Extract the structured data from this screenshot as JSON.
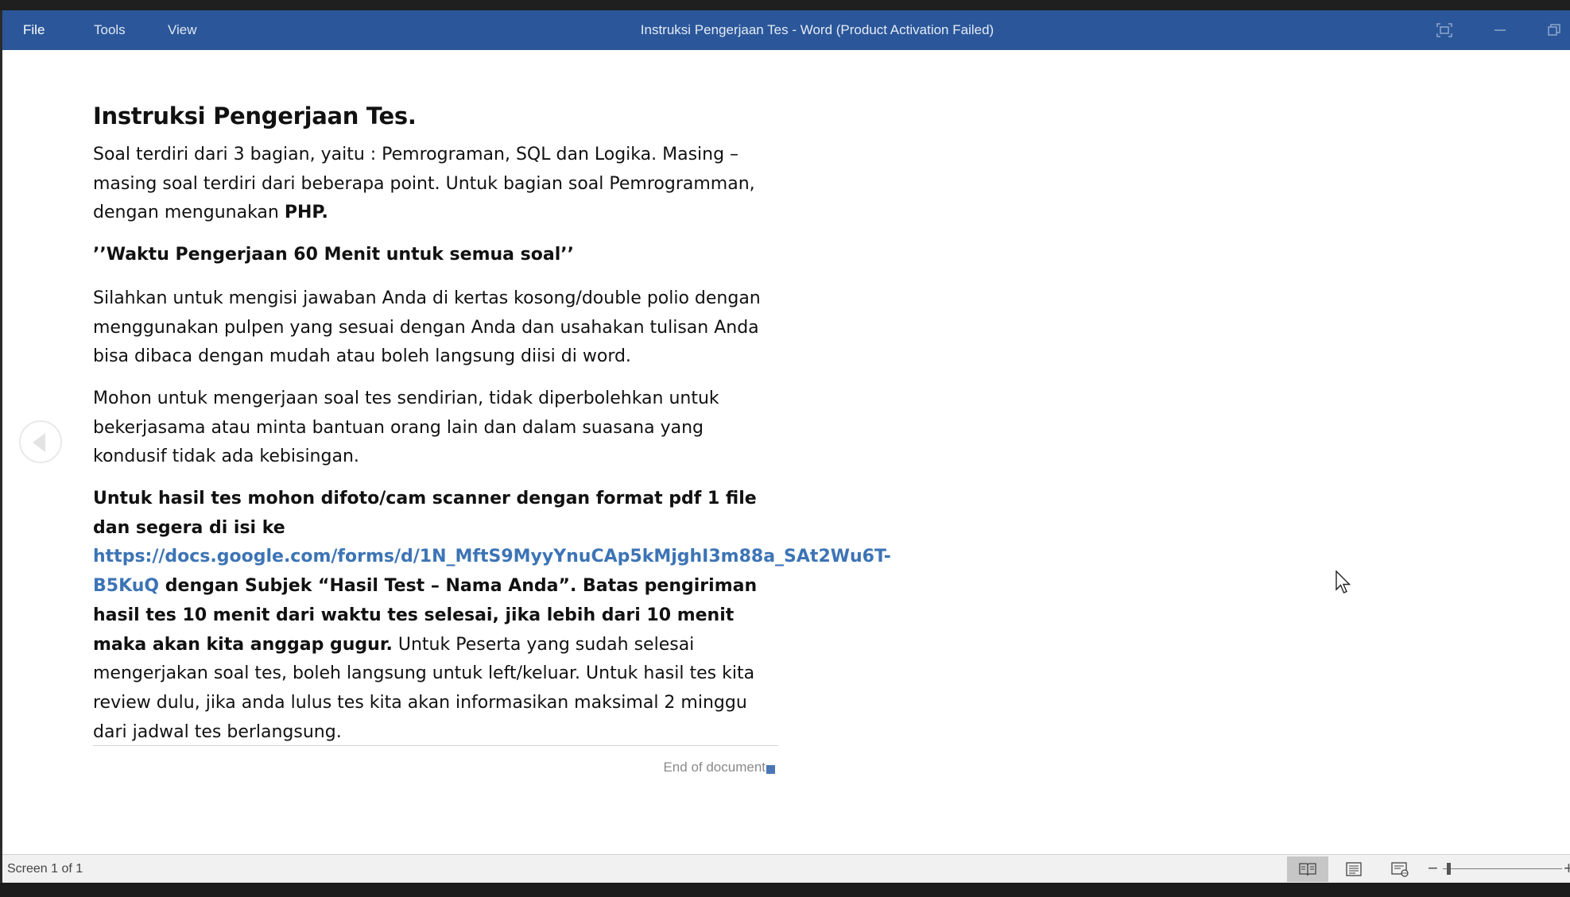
{
  "titlebar": {
    "menu": [
      {
        "label": "File"
      },
      {
        "label": "Tools"
      },
      {
        "label": "View"
      }
    ],
    "window_title": "Instruksi Pengerjaan Tes - Word (Product Activation Failed)"
  },
  "document": {
    "heading": "Instruksi Pengerjaan Tes.",
    "p1_text": "Soal terdiri dari 3 bagian, yaitu : Pemrograman, SQL dan Logika. Masing – masing soal terdiri dari beberapa point. Untuk bagian soal Pemrogramman, dengan mengunakan ",
    "p1_bold": "PHP.",
    "quote": "’’Waktu Pengerjaan 60 Menit untuk semua soal’’",
    "p2": "Silahkan untuk mengisi jawaban Anda di kertas kosong/double polio dengan menggunakan pulpen yang sesuai dengan Anda dan usahakan tulisan Anda bisa dibaca dengan mudah atau boleh langsung diisi di word.",
    "p3": "Mohon untuk mengerjaan soal tes sendirian, tidak diperbolehkan untuk bekerjasama atau minta bantuan orang lain dan dalam suasana yang kondusif tidak ada kebisingan.",
    "p4_bold_intro": "Untuk hasil tes mohon difoto/cam scanner dengan format pdf 1 file dan segera di isi ke",
    "p4_link": "https://docs.google.com/forms/d/1N_MftS9MyyYnuCAp5kMjghI3m88a_SAt2Wu6T-B5KuQ",
    "p4_bold_rest": " dengan Subjek “Hasil Test – Nama Anda”. Batas pengiriman hasil tes 10 menit dari waktu tes selesai, jika lebih dari 10 menit maka akan kita anggap gugur.",
    "p4_regular": " Untuk Peserta yang sudah selesai mengerjakan soal tes, boleh langsung untuk left/keluar. Untuk hasil tes kita review dulu, jika anda lulus tes kita akan informasikan maksimal 2 minggu dari jadwal tes berlangsung.",
    "end_marker": "End of document"
  },
  "statusbar": {
    "page_info": "Screen 1 of 1",
    "zoom_minus": "−",
    "zoom_plus": "+"
  },
  "colors": {
    "titlebar": "#2b579a",
    "link": "#3c74b5",
    "end_marker_square": "#4a77b4"
  },
  "icons": [
    "focus-mode-icon",
    "minimize-icon",
    "restore-icon",
    "previous-screen-icon",
    "mouse-cursor-icon",
    "read-mode-icon",
    "print-layout-icon",
    "web-layout-icon"
  ]
}
